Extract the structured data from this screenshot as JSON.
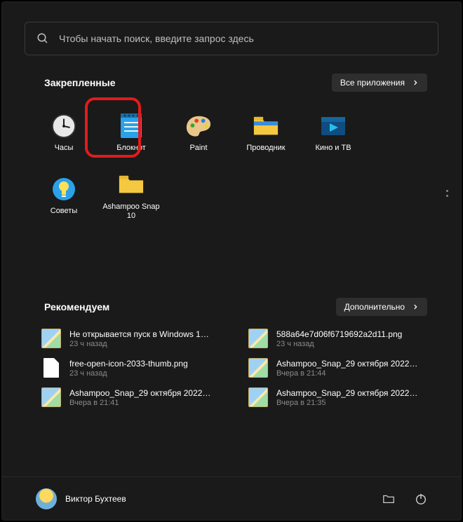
{
  "search": {
    "placeholder": "Чтобы начать поиск, введите запрос здесь"
  },
  "pinned": {
    "title": "Закрепленные",
    "all_apps": "Все приложения",
    "items": [
      {
        "label": "Часы",
        "icon": "clock-icon"
      },
      {
        "label": "Блокнот",
        "icon": "notepad-icon"
      },
      {
        "label": "Paint",
        "icon": "paint-icon"
      },
      {
        "label": "Проводник",
        "icon": "explorer-icon"
      },
      {
        "label": "Кино и ТВ",
        "icon": "movies-icon"
      },
      {
        "label": "Советы",
        "icon": "tips-icon"
      },
      {
        "label": "Ashampoo Snap 10",
        "icon": "folder-icon"
      }
    ]
  },
  "recommended": {
    "title": "Рекомендуем",
    "more": "Дополнительно",
    "items": [
      {
        "title": "Не открывается пуск в Windows 1…",
        "time": "23 ч назад",
        "thumb": "image"
      },
      {
        "title": "588a64e7d06f6719692a2d11.png",
        "time": "23 ч назад",
        "thumb": "image"
      },
      {
        "title": "free-open-icon-2033-thumb.png",
        "time": "23 ч назад",
        "thumb": "doc"
      },
      {
        "title": "Ashampoo_Snap_29 октября 2022…",
        "time": "Вчера в 21:44",
        "thumb": "image"
      },
      {
        "title": "Ashampoo_Snap_29 октября 2022…",
        "time": "Вчера в 21:41",
        "thumb": "image"
      },
      {
        "title": "Ashampoo_Snap_29 октября 2022…",
        "time": "Вчера в 21:35",
        "thumb": "image"
      }
    ]
  },
  "user": {
    "name": "Виктор Бухтеев"
  }
}
